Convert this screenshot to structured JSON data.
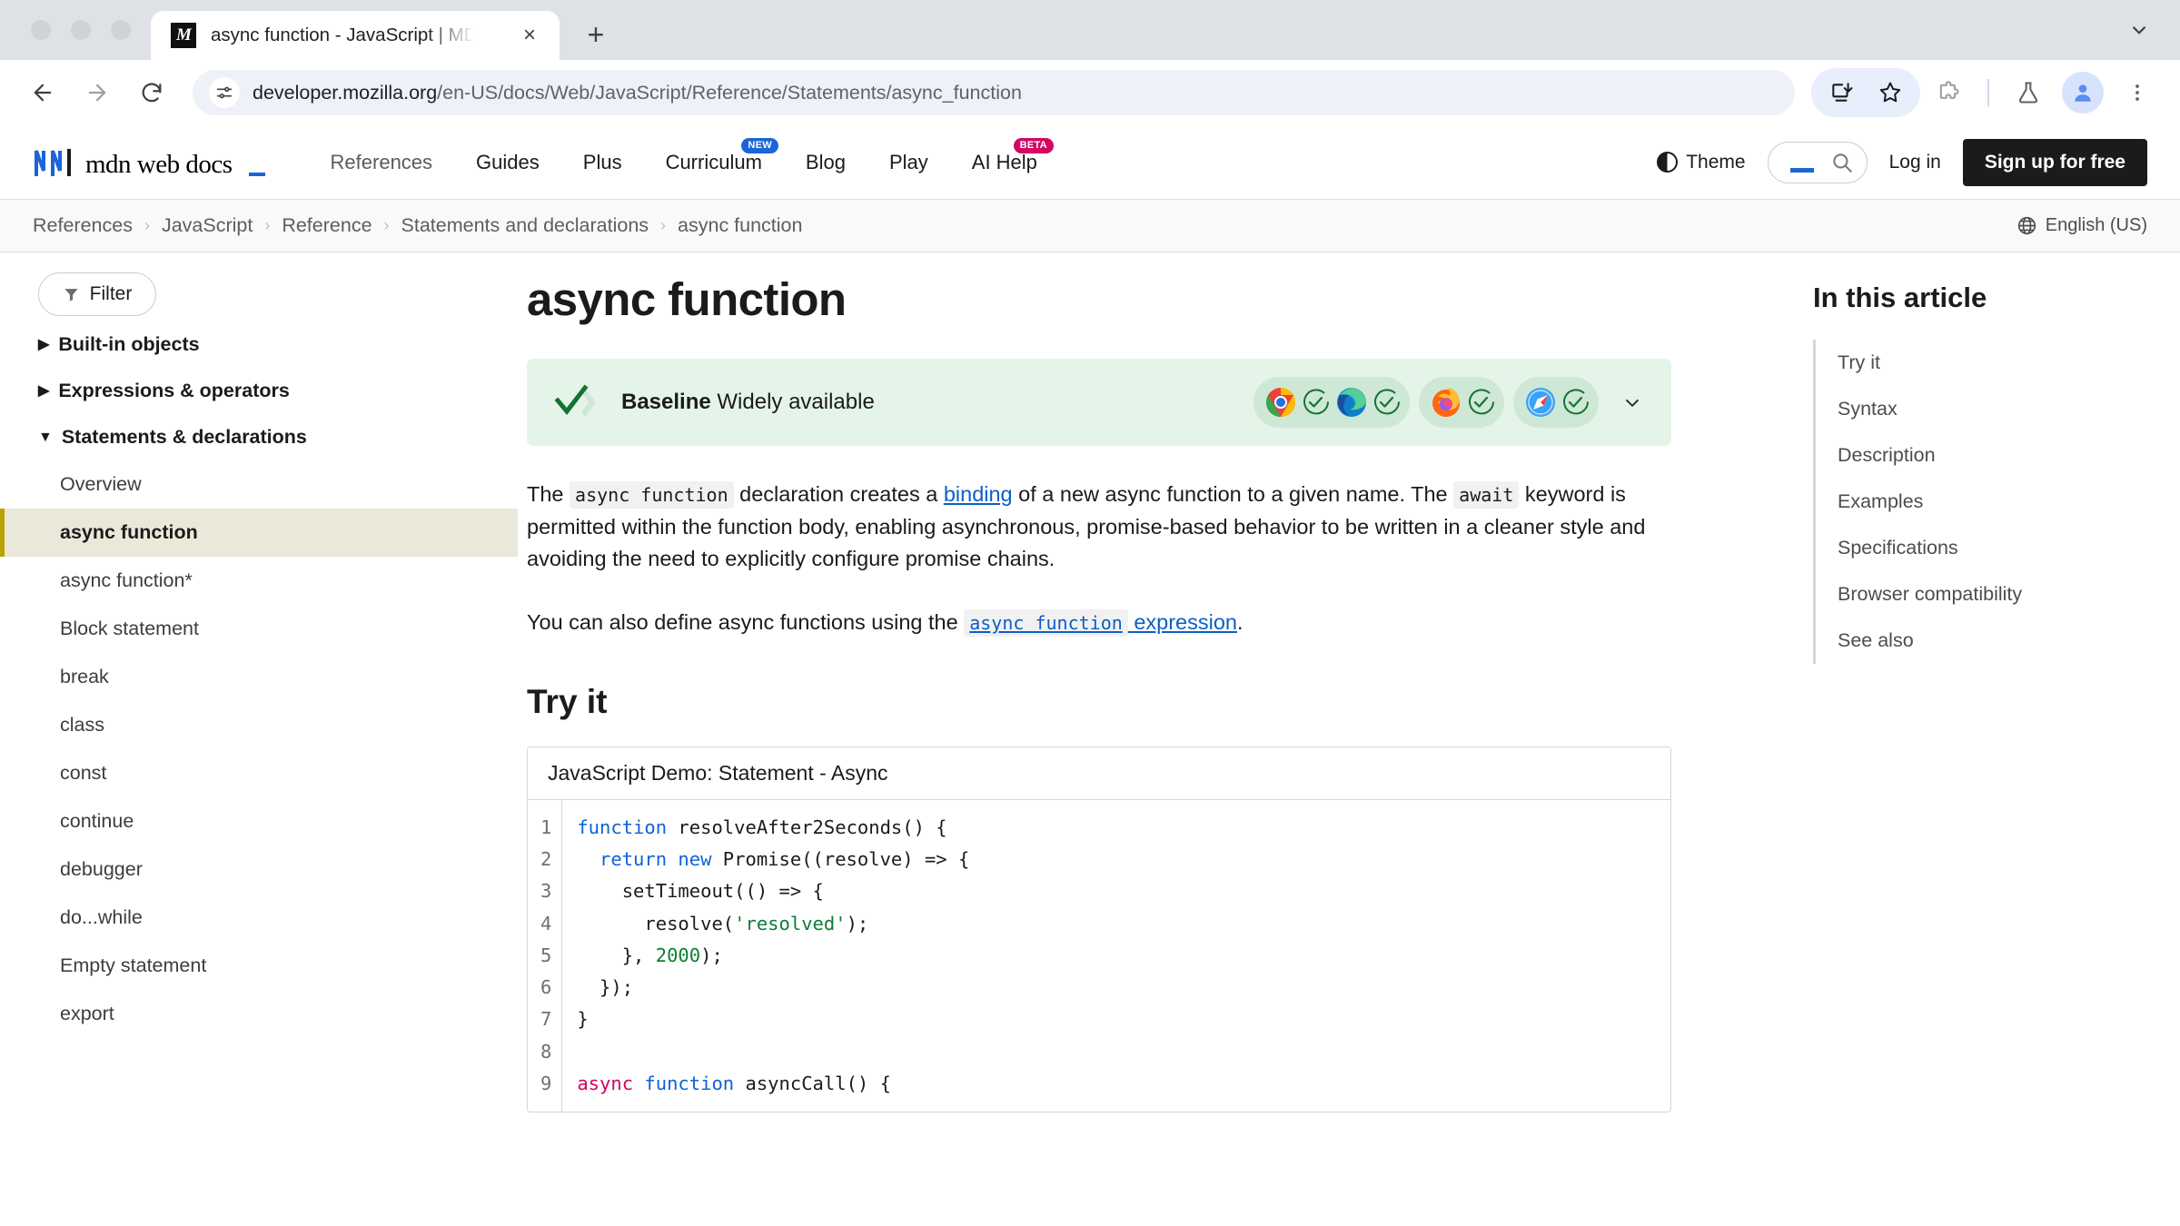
{
  "browser": {
    "tab": {
      "title": "async function - JavaScript | MDN",
      "favicon": "mdn-favicon",
      "close_label": "×"
    },
    "new_tab_label": "+",
    "url": {
      "domain": "developer.mozilla.org",
      "path": "/en-US/docs/Web/JavaScript/Reference/Statements/async_function"
    },
    "toolbar_icons": [
      "back-icon",
      "forward-icon",
      "reload-icon",
      "site-info-icon",
      "install-icon",
      "bookmark-star-icon",
      "extensions-icon",
      "labs-flask-icon",
      "profile-icon",
      "menu-kebab-icon"
    ]
  },
  "header": {
    "logo_text": "mdn web docs",
    "nav": [
      {
        "label": "References",
        "badge": null,
        "muted": true
      },
      {
        "label": "Guides",
        "badge": null,
        "muted": false
      },
      {
        "label": "Plus",
        "badge": null,
        "muted": false
      },
      {
        "label": "Curriculum",
        "badge": "NEW",
        "badge_kind": "new",
        "muted": false
      },
      {
        "label": "Blog",
        "badge": null,
        "muted": false
      },
      {
        "label": "Play",
        "badge": null,
        "muted": false
      },
      {
        "label": "AI Help",
        "badge": "BETA",
        "badge_kind": "beta",
        "muted": false
      }
    ],
    "theme_label": "Theme",
    "search_placeholder": "",
    "search_value": "",
    "login_label": "Log in",
    "signup_label": "Sign up for free"
  },
  "breadcrumb": {
    "items": [
      "References",
      "JavaScript",
      "Reference",
      "Statements and declarations",
      "async function"
    ],
    "separator": "›",
    "language": "English (US)"
  },
  "sidebar": {
    "filter_label": "Filter",
    "groups": [
      {
        "label": "Built-in objects",
        "expanded": false,
        "faded": true,
        "marker": "▶"
      },
      {
        "label": "Expressions & operators",
        "expanded": false,
        "faded": false,
        "marker": "▶"
      },
      {
        "label": "Statements & declarations",
        "expanded": true,
        "faded": false,
        "marker": "▼"
      }
    ],
    "items": [
      {
        "label": "Overview",
        "active": false
      },
      {
        "label": "async function",
        "active": true
      },
      {
        "label": "async function*",
        "active": false
      },
      {
        "label": "Block statement",
        "active": false
      },
      {
        "label": "break",
        "active": false
      },
      {
        "label": "class",
        "active": false
      },
      {
        "label": "const",
        "active": false
      },
      {
        "label": "continue",
        "active": false
      },
      {
        "label": "debugger",
        "active": false
      },
      {
        "label": "do...while",
        "active": false
      },
      {
        "label": "Empty statement",
        "active": false
      },
      {
        "label": "export",
        "active": false
      }
    ]
  },
  "article": {
    "title": "async function",
    "baseline": {
      "bold_label": "Baseline",
      "status_label": "Widely available",
      "browsers": [
        {
          "name": "chrome",
          "supported": true
        },
        {
          "name": "edge",
          "supported": true
        },
        {
          "name": "firefox",
          "supported": true
        },
        {
          "name": "safari",
          "supported": true
        }
      ],
      "expand_icon": "chevron-down-icon",
      "bg_color": "#e5f4e8"
    },
    "paragraph1": {
      "p1": "The ",
      "code1": "async function",
      "p2": " declaration creates a ",
      "link1": "binding",
      "p3": " of a new async function to a given name. The ",
      "code2": "await",
      "p4": " keyword is permitted within the function body, enabling asynchronous, promise-based behavior to be written in a cleaner style and avoiding the need to explicitly configure promise chains."
    },
    "paragraph2": {
      "p1": "You can also define async functions using the ",
      "link_code": "async function",
      "link_text": " expression",
      "p2": "."
    },
    "tryit_heading": "Try it",
    "demo": {
      "title": "JavaScript Demo: Statement - Async",
      "line_numbers": [
        "1",
        "2",
        "3",
        "4",
        "5",
        "6",
        "7",
        "8",
        "9"
      ],
      "code_lines": [
        "function resolveAfter2Seconds() {",
        "  return new Promise((resolve) => {",
        "    setTimeout(() => {",
        "      resolve('resolved');",
        "    }, 2000);",
        "  });",
        "}",
        "",
        "async function asyncCall() {"
      ]
    }
  },
  "toc": {
    "heading": "In this article",
    "items": [
      "Try it",
      "Syntax",
      "Description",
      "Examples",
      "Specifications",
      "Browser compatibility",
      "See also"
    ]
  },
  "colors": {
    "accent_blue": "#1b65d6",
    "link_blue": "#0b5fc6",
    "badge_new": "#1b65d6",
    "badge_beta": "#d40763",
    "baseline_green": "#e5f4e8",
    "active_sidebar": "#eae8d9",
    "active_sidebar_bar": "#b8a100"
  }
}
